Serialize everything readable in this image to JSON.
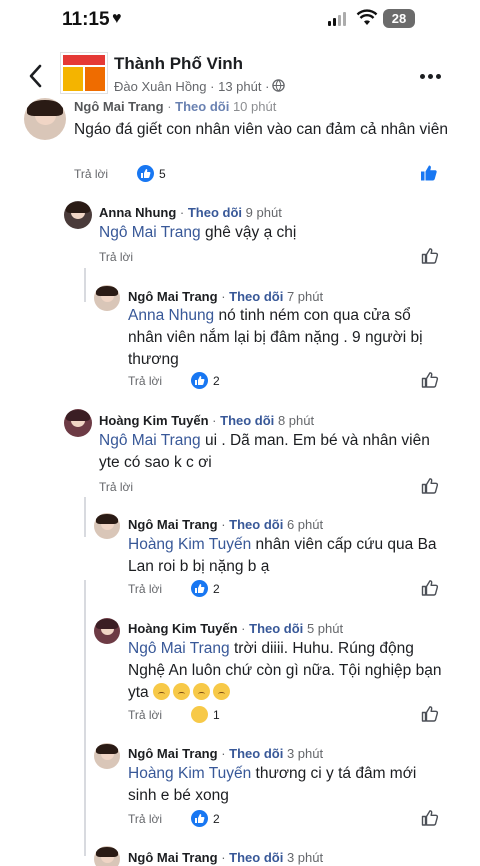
{
  "status": {
    "time": "11:15",
    "battery": "28"
  },
  "header": {
    "group_name": "Thành Phố Vinh",
    "author": "Đào Xuân Hồng",
    "time": "13 phút"
  },
  "labels": {
    "reply": "Trả lời",
    "follow": "Theo dõi",
    "dot": "·"
  },
  "comments": [
    {
      "name": "Ngô Mai Trang",
      "time": "10 phút",
      "text": "Ngáo đá giết con nhân viên vào can đảm cả nhân viên",
      "reactions": "5",
      "reaction_type": "like"
    },
    {
      "name": "Anna Nhung",
      "time": "9 phút",
      "mention": "Ngô Mai Trang",
      "text": " ghê vậy ạ chị"
    },
    {
      "name": "Ngô Mai Trang",
      "time": "7 phút",
      "mention": "Anna Nhung",
      "text_line1": " nó tinh ném con qua cửa sổ",
      "text_line2": "nhân viên  nắm lại bị đâm nặng . 9 người bị",
      "text_line3": "thương",
      "reactions": "2",
      "reaction_type": "like"
    },
    {
      "name": "Hoàng Kim Tuyến",
      "time": "8 phút",
      "mention": "Ngô Mai Trang",
      "text_line1": " ui . Dã man. Em bé và nhân viên",
      "text_line2": "yte có sao k c ơi"
    },
    {
      "name": "Ngô Mai Trang",
      "time": "6 phút",
      "mention": "Hoàng Kim Tuyến",
      "text_line1": " nhân viên cấp cứu qua Ba",
      "text_line2": "Lan roi b bị nặng b ạ",
      "reactions": "2",
      "reaction_type": "like"
    },
    {
      "name": "Hoàng Kim Tuyến",
      "time": "5 phút",
      "mention": "Ngô Mai Trang",
      "text_line1": " trời diiii. Huhu. Rúng động",
      "text_line2": "Nghệ An luôn chứ còn gì nữa. Tội nghiệp bạn",
      "text_line3": "yta",
      "reactions": "1",
      "reaction_type": "sad"
    },
    {
      "name": "Ngô Mai Trang",
      "time": "3 phút",
      "mention": "Hoàng Kim Tuyến",
      "text_line1": " thương ci y tá đâm mới",
      "text_line2": "sinh e bé xong",
      "reactions": "2",
      "reaction_type": "like"
    },
    {
      "name": "Ngô Mai Trang",
      "time": "3 phút"
    }
  ]
}
